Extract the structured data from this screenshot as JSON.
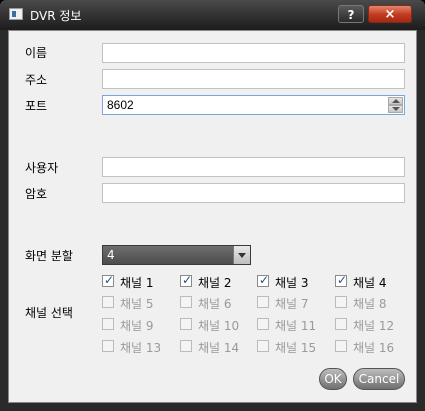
{
  "window": {
    "title": "DVR 정보",
    "help_label": "?",
    "close_label": "×"
  },
  "form": {
    "name_label": "이름",
    "address_label": "주소",
    "port_label": "포트",
    "port_value": "8602",
    "user_label": "사용자",
    "password_label": "암호",
    "split_label": "화면 분할",
    "split_value": "4",
    "channel_select_label": "채널 선택"
  },
  "channels": [
    {
      "label": "채널 1",
      "checked": true,
      "enabled": true
    },
    {
      "label": "채널 2",
      "checked": true,
      "enabled": true
    },
    {
      "label": "채널 3",
      "checked": true,
      "enabled": true
    },
    {
      "label": "채널 4",
      "checked": true,
      "enabled": true
    },
    {
      "label": "채널 5",
      "checked": false,
      "enabled": false
    },
    {
      "label": "채널 6",
      "checked": false,
      "enabled": false
    },
    {
      "label": "채널 7",
      "checked": false,
      "enabled": false
    },
    {
      "label": "채널 8",
      "checked": false,
      "enabled": false
    },
    {
      "label": "채널 9",
      "checked": false,
      "enabled": false
    },
    {
      "label": "채널 10",
      "checked": false,
      "enabled": false
    },
    {
      "label": "채널 11",
      "checked": false,
      "enabled": false
    },
    {
      "label": "채널 12",
      "checked": false,
      "enabled": false
    },
    {
      "label": "채널 13",
      "checked": false,
      "enabled": false
    },
    {
      "label": "채널 14",
      "checked": false,
      "enabled": false
    },
    {
      "label": "채널 15",
      "checked": false,
      "enabled": false
    },
    {
      "label": "채널 16",
      "checked": false,
      "enabled": false
    }
  ],
  "buttons": {
    "ok_label": "OK",
    "cancel_label": "Cancel"
  },
  "colors": {
    "close_red": "#c2391f",
    "check_blue": "#2a4c8a"
  }
}
